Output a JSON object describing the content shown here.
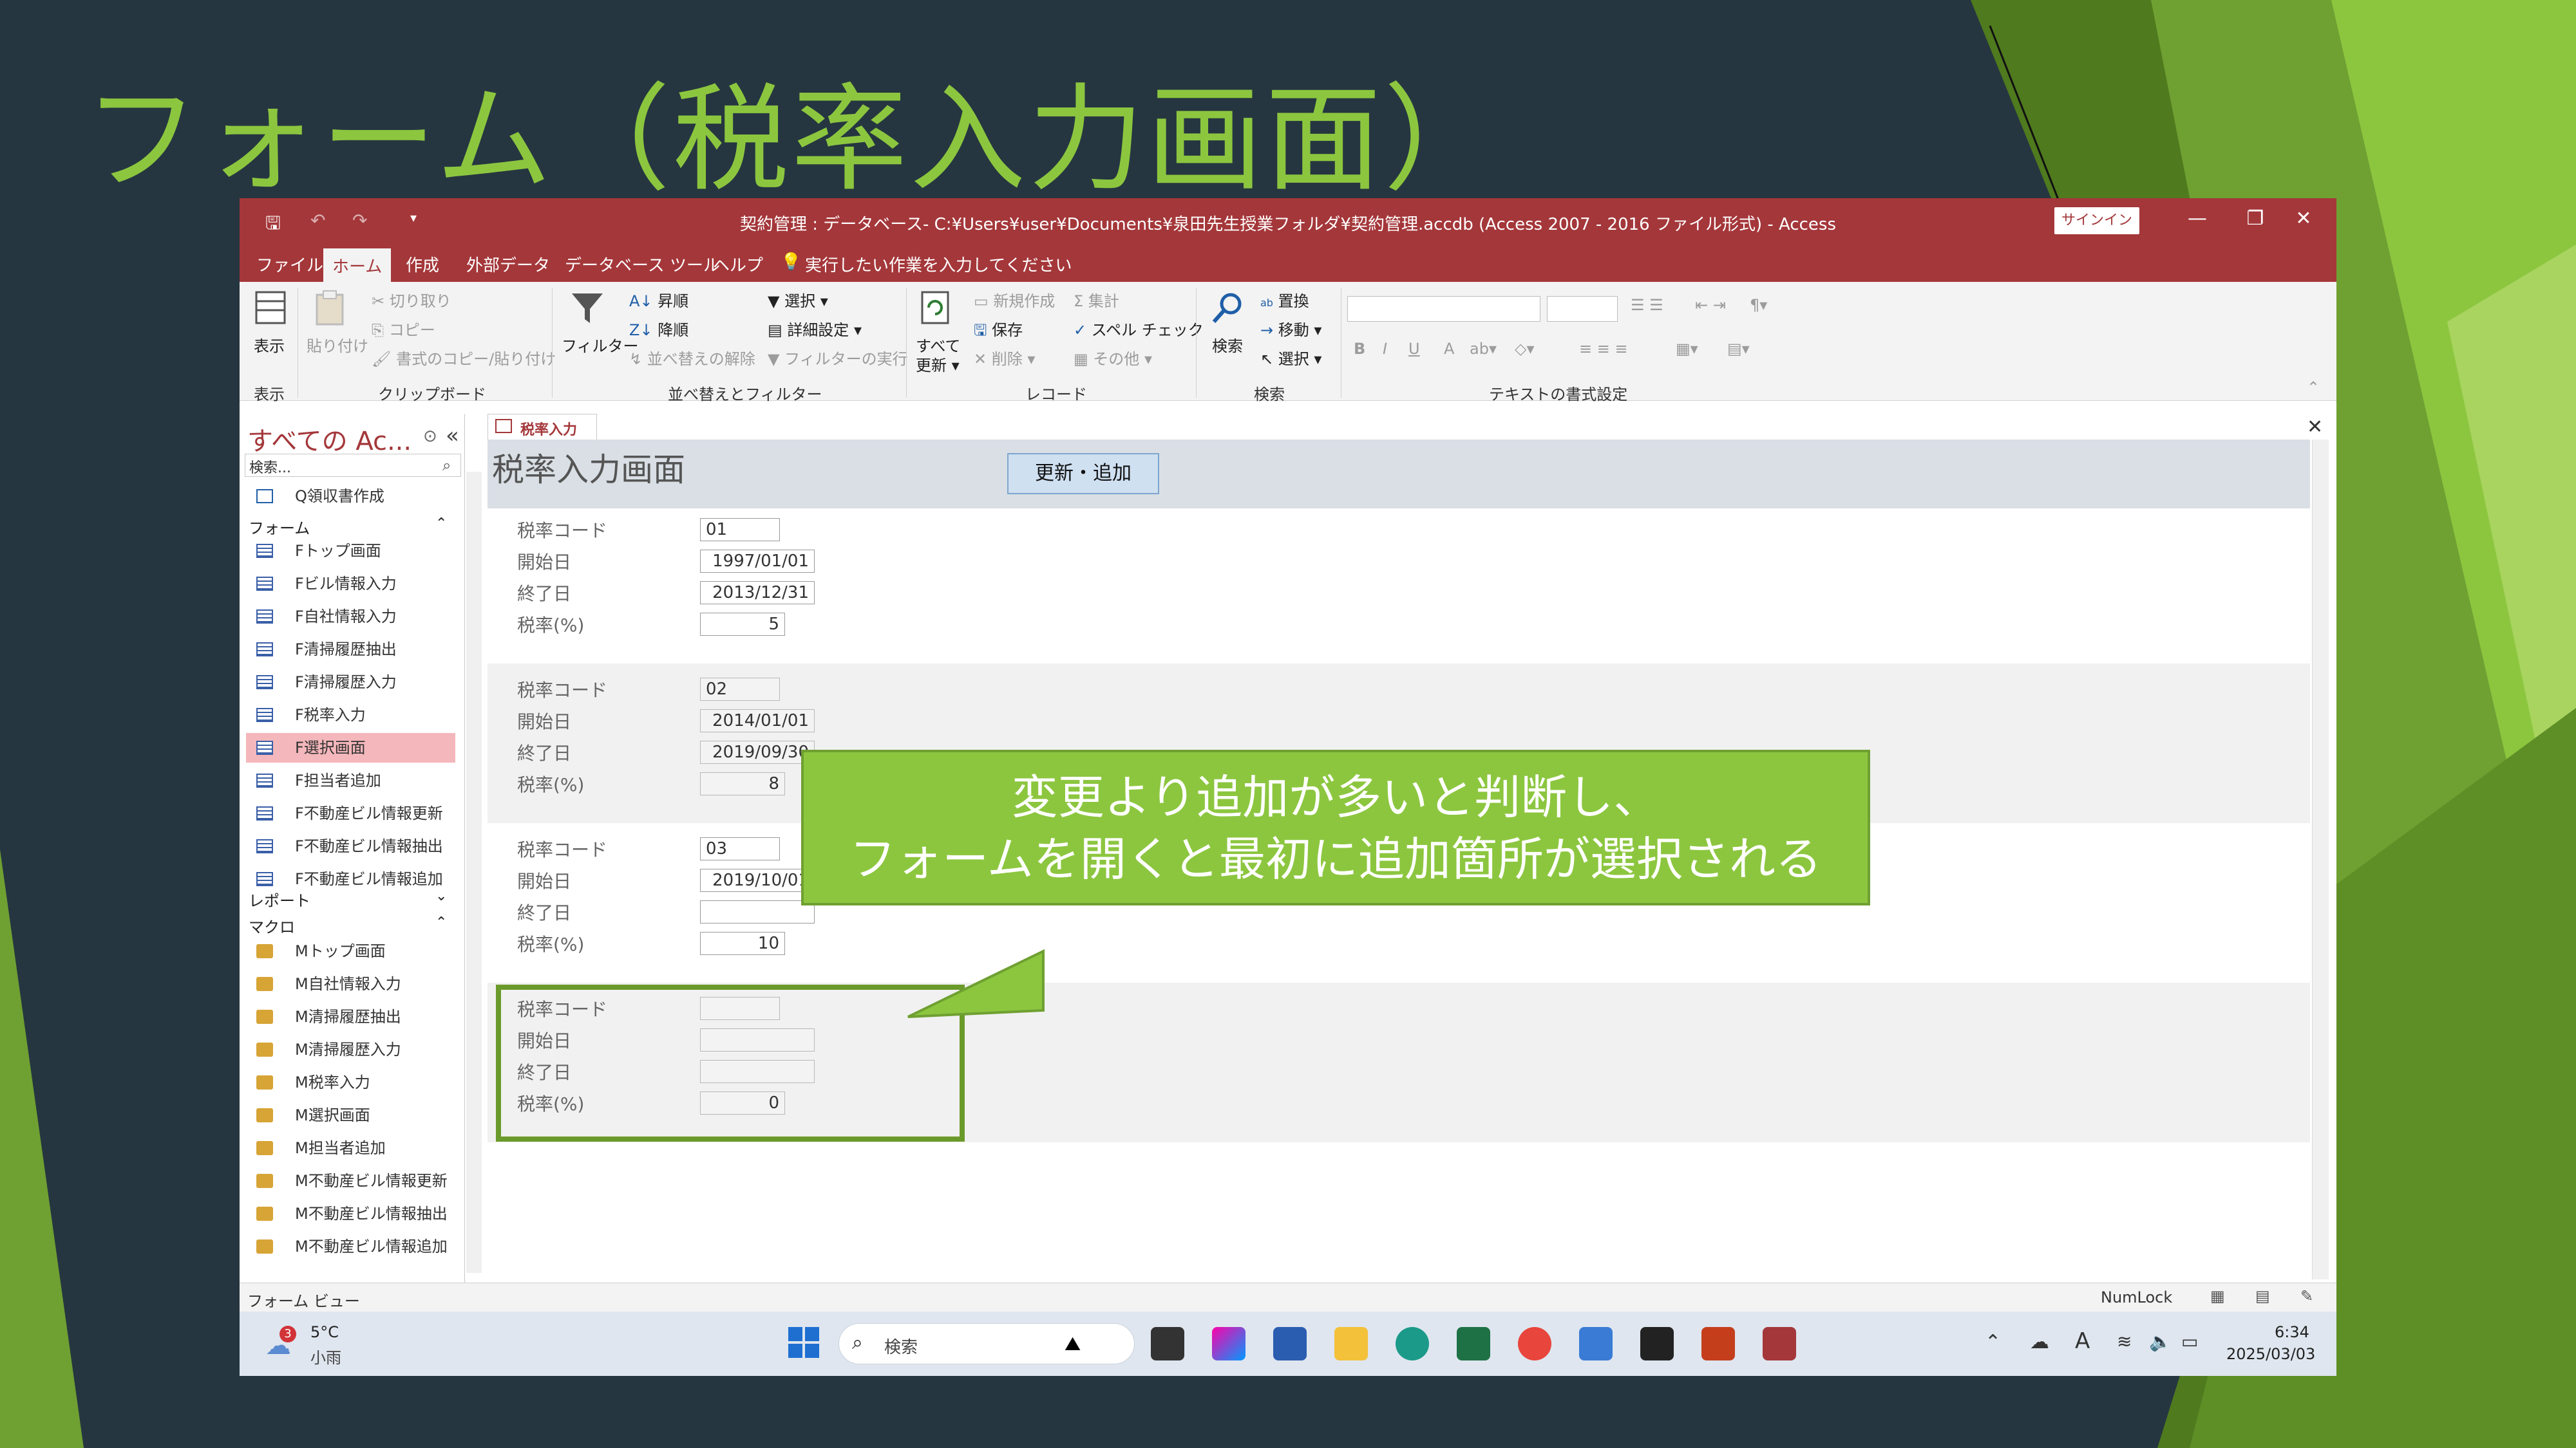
{
  "slide": {
    "title": "フォーム（税率入力画面）"
  },
  "titlebar": {
    "title": "契約管理 : データベース- C:¥Users¥user¥Documents¥泉田先生授業フォルダ¥契約管理.accdb (Access 2007 - 2016 ファイル形式)  -  Access",
    "signin": "サインイン",
    "save_icon": "save-icon",
    "undo_icon": "undo-icon",
    "redo_icon": "redo-icon",
    "min": "—",
    "max": "❐",
    "close": "✕"
  },
  "menu": {
    "items": [
      "ファイル",
      "ホーム",
      "作成",
      "外部データ",
      "データベース ツール",
      "ヘルプ"
    ],
    "tellme": "実行したい作業を入力してください"
  },
  "ribbon": {
    "view": "表示",
    "view_group": "表示",
    "paste": "貼り付け",
    "cut": "切り取り",
    "copy": "コピー",
    "format_painter": "書式のコピー/貼り付け",
    "clipboard_group": "クリップボード",
    "filter": "フィルター",
    "asc": "昇順",
    "desc": "降順",
    "clear_sort": "並べ替えの解除",
    "selection": "選択 ▾",
    "advanced": "詳細設定 ▾",
    "toggle_filter": "フィルターの実行",
    "sort_group": "並べ替えとフィルター",
    "refresh": "すべて",
    "refresh2": "更新 ▾",
    "new": "新規作成",
    "save": "保存",
    "delete": "削除 ▾",
    "totals": "集計",
    "spelling": "スペル チェック",
    "more": "その他 ▾",
    "record_group": "レコード",
    "find": "検索",
    "replace": "置換",
    "goto": "移動 ▾",
    "select": "選択 ▾",
    "find_group": "検索",
    "text_group": "テキストの書式設定",
    "bold": "B",
    "italic": "I",
    "underline": "U",
    "font_color": "A"
  },
  "nav": {
    "title": "すべての Ac...",
    "search_placeholder": "検索...",
    "query_item": "Q領収書作成",
    "forms_group": "フォーム",
    "forms": [
      "Fトップ画面",
      "Fビル情報入力",
      "F自社情報入力",
      "F清掃履歴抽出",
      "F清掃履歴入力",
      "F税率入力",
      "F選択画面",
      "F担当者追加",
      "F不動産ビル情報更新",
      "F不動産ビル情報抽出",
      "F不動産ビル情報追加"
    ],
    "reports_group": "レポート",
    "macros_group": "マクロ",
    "macros": [
      "Mトップ画面",
      "M自社情報入力",
      "M清掃履歴抽出",
      "M清掃履歴入力",
      "M税率入力",
      "M選択画面",
      "M担当者追加",
      "M不動産ビル情報更新",
      "M不動産ビル情報抽出",
      "M不動産ビル情報追加"
    ]
  },
  "doc": {
    "tab": "税率入力",
    "form_title": "税率入力画面",
    "update_button": "更新・追加",
    "labels": {
      "code": "税率コード",
      "start": "開始日",
      "end": "終了日",
      "rate": "税率(%)"
    },
    "records": [
      {
        "code": "01",
        "start": "1997/01/01",
        "end": "2013/12/31",
        "rate": "5"
      },
      {
        "code": "02",
        "start": "2014/01/01",
        "end": "2019/09/30",
        "rate": "8"
      },
      {
        "code": "03",
        "start": "2019/10/01",
        "end": "",
        "rate": "10"
      },
      {
        "code": "",
        "start": "",
        "end": "",
        "rate": "0"
      }
    ]
  },
  "callout": {
    "line1": "変更より追加が多いと判断し、",
    "line2": "フォームを開くと最初に追加箇所が選択される"
  },
  "status": {
    "left": "フォーム ビュー",
    "numlock": "NumLock"
  },
  "taskbar": {
    "weather_temp": "5°C",
    "weather_desc": "小雨",
    "weather_badge": "3",
    "search": "検索",
    "time": "6:34",
    "date": "2025/03/03"
  }
}
